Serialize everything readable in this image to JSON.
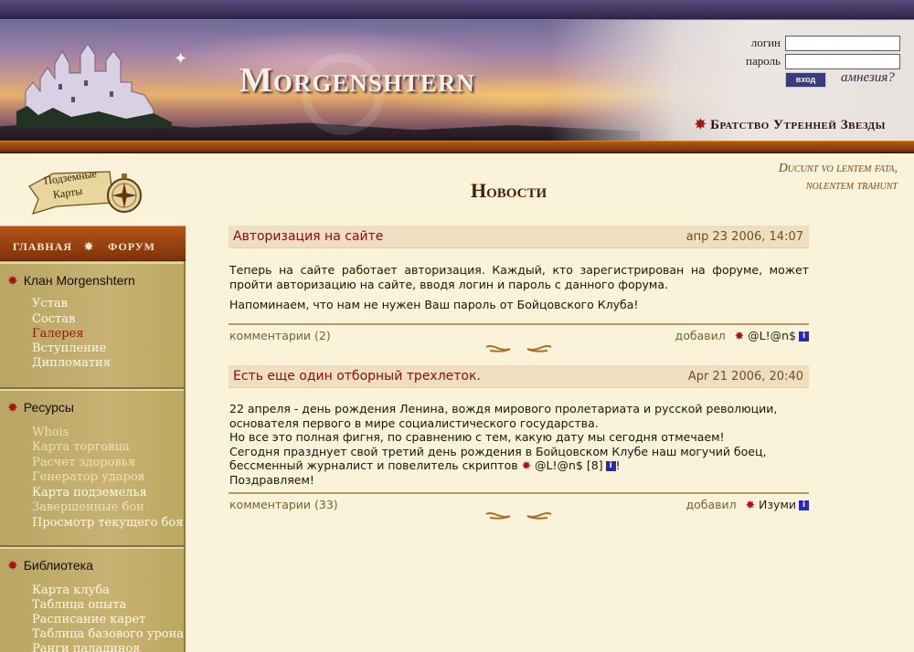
{
  "header": {
    "site_title": "Morgenshtern",
    "login_label": "логин",
    "password_label": "пароль",
    "enter_button": "вход",
    "amnesia_link": "амнезия?",
    "brotherhood_link": "Братство Утренней Звезды"
  },
  "logo": {
    "line1": "Подземные",
    "line2": "Карты"
  },
  "motto": {
    "line1": "Ducunt vo lentem fata,",
    "line2": "nolentem trahunt"
  },
  "page_title": "Новости",
  "nav": {
    "main": "ГЛАВНАЯ",
    "forum": "ФОРУМ"
  },
  "sidebar": {
    "sections": [
      {
        "title": "Клан Morgenshtern",
        "links": [
          "Устав",
          "Состав",
          "Галерея",
          "Вступление",
          "Дипломатия"
        ],
        "active": "Галерея"
      },
      {
        "title": "Ресурсы",
        "links": [
          "Whois",
          "Карта торговца",
          "Расчет здоровья",
          "Генератор ударов",
          "Карта подземелья",
          "Завершенные бои",
          "Просмотр текущего боя"
        ]
      },
      {
        "title": "Библиотека",
        "links": [
          "Карта клуба",
          "Таблица опыта",
          "Расписание карет",
          "Таблица базового урона",
          "Ранги паладинов"
        ]
      }
    ]
  },
  "news": [
    {
      "title": "Авторизация на сайте",
      "date": "апр 23 2006, 14:07",
      "paragraphs": [
        "Теперь на сайте работает авторизация. Каждый, кто зарегистрирован на форуме, может пройти авторизацию на сайте, вводя логин и пароль с данного форума.",
        "Напоминаем, что нам не нужен Ваш пароль от Бойцовского Клуба!"
      ],
      "comments": "комментарии (2)",
      "added_label": "добавил",
      "author": "@L!@n$"
    },
    {
      "title": "Есть еще один отборный трехлеток.",
      "date": "Apr 21 2006, 20:40",
      "lines": [
        "22 апреля - день рождения Ленина, вождя мирового пролетариата и русской революции,",
        "основателя первого в мире социалистического государства.",
        "Но все это полная фигня, по сравнению с тем, какую дату мы сегодня отмечаем!",
        "Сегодня празднует свой третий день рождения в Бойцовском Клубе наш могучий боец,",
        "бессменный журналист и повелитель скриптов",
        "Поздравляем!"
      ],
      "inline_nick": "@L!@n$",
      "inline_level": "[8]",
      "exclaim": "!",
      "comments": "комментарии (33)",
      "added_label": "добавил",
      "author": "Изуми"
    }
  ],
  "colors": {
    "accent_red": "#8a0c10",
    "sidebar": "#c9b06c",
    "nav_bar": "#9a4412",
    "background": "#fbf3d9"
  },
  "icons": [
    "castle-icon",
    "compass-icon",
    "star-icon",
    "info-icon",
    "flourish-icon"
  ]
}
